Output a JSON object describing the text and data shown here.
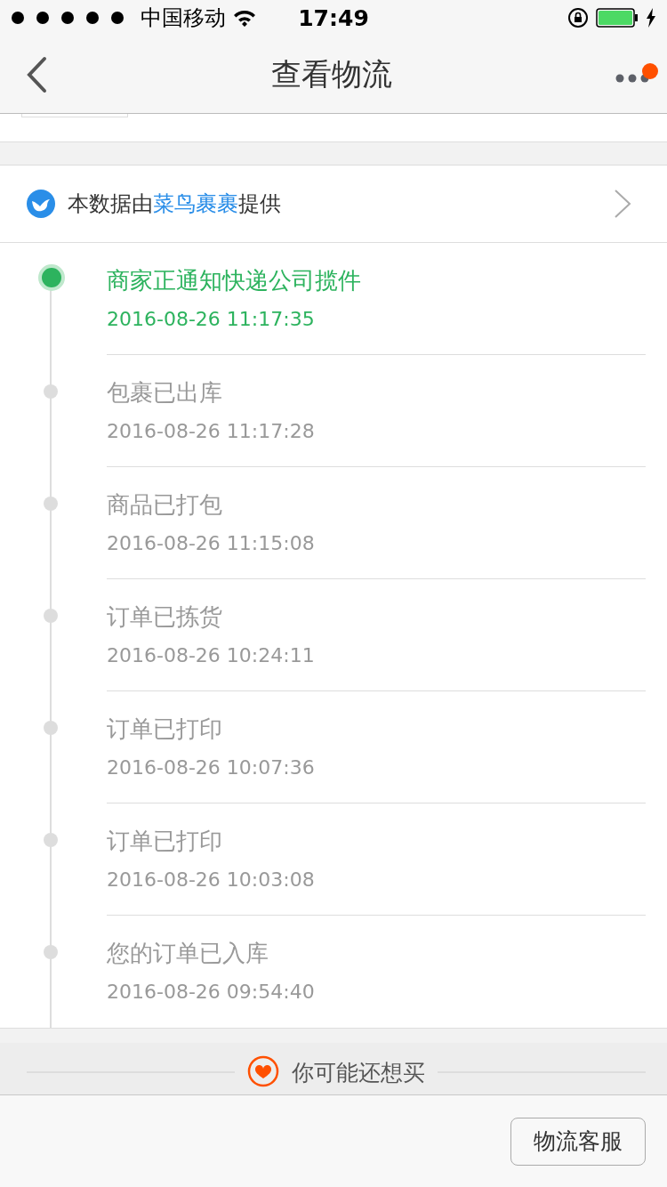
{
  "status_bar": {
    "carrier": "中国移动",
    "time": "17:49"
  },
  "nav": {
    "title": "查看物流",
    "has_notification": true
  },
  "provider": {
    "prefix": "本数据由",
    "name": "菜鸟裹裹",
    "suffix": "提供"
  },
  "events": [
    {
      "title": "商家正通知快递公司揽件",
      "time": "2016-08-26 11:17:35",
      "current": true
    },
    {
      "title": "包裹已出库",
      "time": "2016-08-26 11:17:28",
      "current": false
    },
    {
      "title": "商品已打包",
      "time": "2016-08-26 11:15:08",
      "current": false
    },
    {
      "title": "订单已拣货",
      "time": "2016-08-26 10:24:11",
      "current": false
    },
    {
      "title": "订单已打印",
      "time": "2016-08-26 10:07:36",
      "current": false
    },
    {
      "title": "订单已打印",
      "time": "2016-08-26 10:03:08",
      "current": false
    },
    {
      "title": "您的订单已入库",
      "time": "2016-08-26 09:54:40",
      "current": false
    }
  ],
  "recommend": {
    "title": "你可能还想买"
  },
  "footer": {
    "button": "物流客服"
  }
}
